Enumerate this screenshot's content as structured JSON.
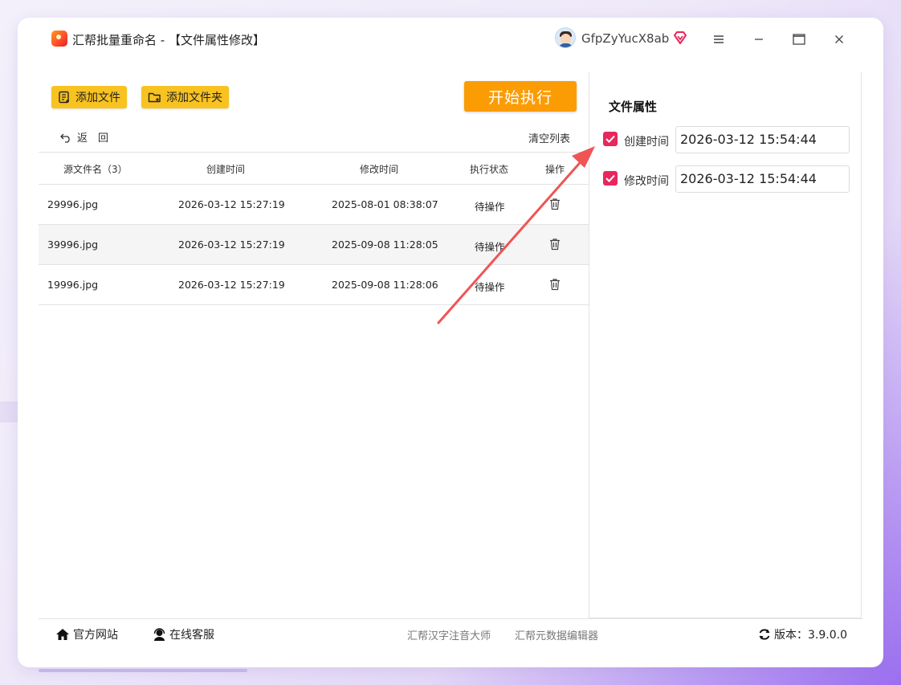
{
  "app": {
    "title": "汇帮批量重命名 - 【文件属性修改】",
    "username": "GfpZyYucX8ab"
  },
  "toolbar": {
    "add_file": "添加文件",
    "add_folder": "添加文件夹",
    "start": "开始执行",
    "back": "返　回",
    "clear_list": "清空列表"
  },
  "table": {
    "headers": {
      "name": "源文件名（3）",
      "created": "创建时间",
      "modified": "修改时间",
      "status": "执行状态",
      "action": "操作"
    },
    "rows": [
      {
        "name": "29996.jpg",
        "created": "2026-03-12 15:27:19",
        "modified": "2025-08-01 08:38:07",
        "status": "待操作"
      },
      {
        "name": "39996.jpg",
        "created": "2026-03-12 15:27:19",
        "modified": "2025-09-08 11:28:05",
        "status": "待操作"
      },
      {
        "name": "19996.jpg",
        "created": "2026-03-12 15:27:19",
        "modified": "2025-09-08 11:28:06",
        "status": "待操作"
      }
    ]
  },
  "panel": {
    "title": "文件属性",
    "create_label": "创建时间",
    "create_value": "2026-03-12 15:54:44",
    "create_checked": true,
    "modify_label": "修改时间",
    "modify_value": "2026-03-12 15:54:44",
    "modify_checked": true
  },
  "footer": {
    "website": "官方网站",
    "support": "在线客服",
    "link1": "汇帮汉字注音大师",
    "link2": "汇帮元数据编辑器",
    "version": "版本：3.9.0.0"
  },
  "colors": {
    "accent_yellow": "#f8c221",
    "accent_orange": "#fb9c05",
    "checkbox": "#e8275c",
    "arrow": "#f05454"
  },
  "icons": [
    "app-logo-icon",
    "avatar-icon",
    "vip-diamond-icon",
    "menu-icon",
    "minimize-icon",
    "maximize-icon",
    "close-icon",
    "add-file-icon",
    "add-folder-icon",
    "back-arrow-icon",
    "trash-icon",
    "checkbox-checked-icon",
    "home-icon",
    "headset-icon",
    "refresh-icon"
  ]
}
